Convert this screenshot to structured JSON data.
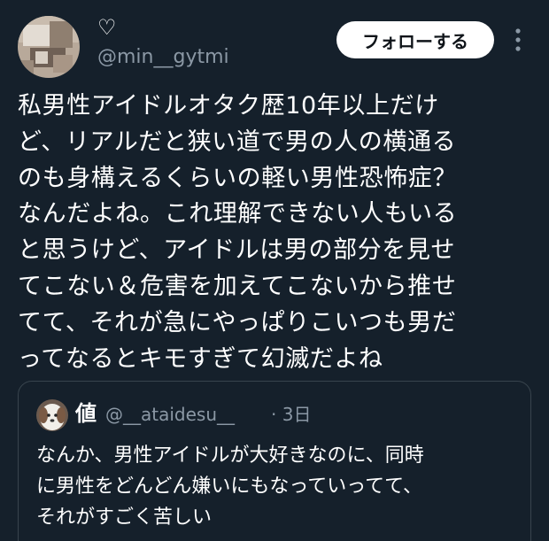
{
  "theme": {
    "background": "#15202b",
    "text_primary": "#ffffff",
    "text_secondary": "#8b98a5",
    "border": "#38444d",
    "follow_button_bg": "#ffffff",
    "follow_button_text": "#0f1419"
  },
  "author": {
    "display_name": "♡",
    "handle": "@min__gytmi",
    "avatar_icon": "user-avatar-photo"
  },
  "actions": {
    "follow_label": "フォローする",
    "more_icon": "more-vertical-icon"
  },
  "tweet": {
    "lines": [
      "私男性アイドルオタク歴10年以上だけ",
      "ど、リアルだと狭い道で男の人の横通る",
      "のも身構えるくらいの軽い男性恐怖症？",
      "なんだよね。これ理解できない人もいる",
      "と思うけど、アイドルは男の部分を見せ",
      "てこない＆危害を加えてこないから推せ",
      "てて、それが急にやっぱりこいつも男だ",
      "ってなるとキモすぎて幻滅だよね"
    ]
  },
  "quote": {
    "display_name": "値",
    "handle": "@__ataidesu__",
    "time": "· 3日",
    "avatar_icon": "dog-avatar-photo",
    "lines": [
      "なんか、男性アイドルが大好きなのに、同時",
      "に男性をどんどん嫌いにもなっていってて、",
      "それがすごく苦しい"
    ]
  }
}
